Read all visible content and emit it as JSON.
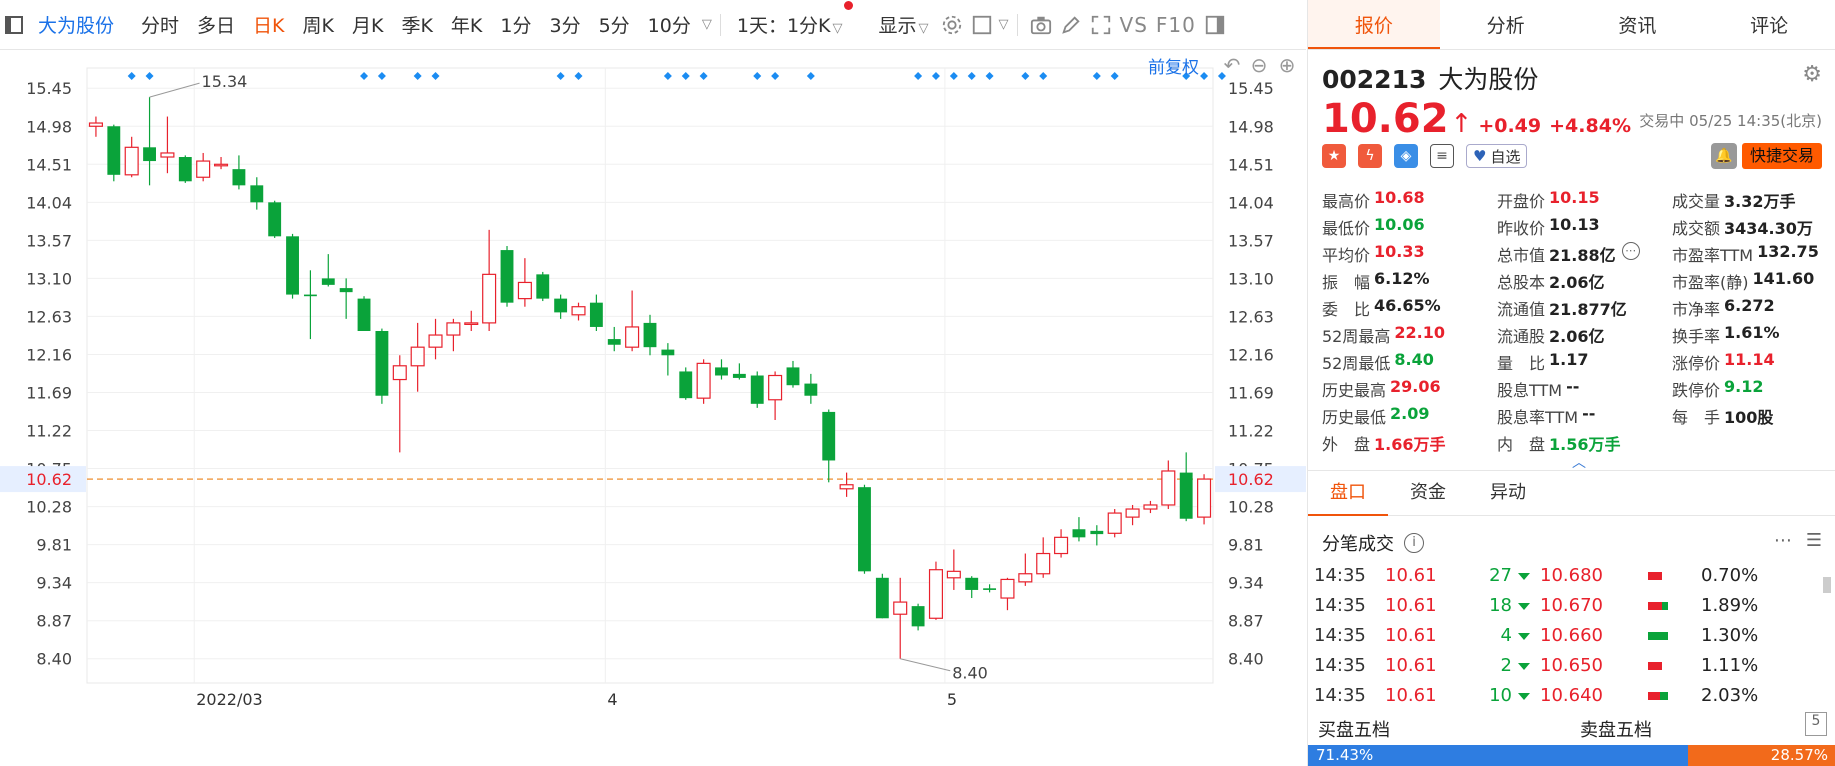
{
  "toolbar": {
    "stock_name": "大为股份",
    "periods": [
      "分时",
      "多日",
      "日K",
      "周K",
      "月K",
      "季K",
      "年K",
      "1分",
      "3分",
      "5分",
      "10分"
    ],
    "active_period": "日K",
    "interval_select": "1天：1分K",
    "display_label": "显示",
    "vs_label": "VS",
    "f10_label": "F10",
    "accent_color": "#f0540b"
  },
  "chart": {
    "restore_label": "前复权",
    "current_price_label": "10.62",
    "max_label": "15.34",
    "min_label": "8.40",
    "up_color": "#e8212c",
    "down_color": "#0aa33a"
  },
  "chart_data": {
    "type": "candlestick",
    "ylim": [
      8.1,
      15.7
    ],
    "yticks": [
      15.45,
      14.98,
      14.51,
      14.04,
      13.57,
      13.1,
      12.63,
      12.16,
      11.69,
      11.22,
      10.75,
      10.28,
      9.81,
      9.34,
      8.87,
      8.4
    ],
    "x_tick_labels": [
      {
        "label": "2022/03",
        "index": 6
      },
      {
        "label": "4",
        "index": 29
      },
      {
        "label": "5",
        "index": 48
      }
    ],
    "current_price": 10.62,
    "candles": [
      {
        "o": 14.98,
        "h": 15.1,
        "l": 14.85,
        "c": 15.02
      },
      {
        "o": 14.98,
        "h": 15.0,
        "l": 14.3,
        "c": 14.38
      },
      {
        "o": 14.38,
        "h": 14.85,
        "l": 14.35,
        "c": 14.72
      },
      {
        "o": 14.72,
        "h": 15.34,
        "l": 14.25,
        "c": 14.55
      },
      {
        "o": 14.6,
        "h": 15.1,
        "l": 14.4,
        "c": 14.65
      },
      {
        "o": 14.6,
        "h": 14.62,
        "l": 14.28,
        "c": 14.3
      },
      {
        "o": 14.35,
        "h": 14.65,
        "l": 14.3,
        "c": 14.55
      },
      {
        "o": 14.51,
        "h": 14.6,
        "l": 14.45,
        "c": 14.51
      },
      {
        "o": 14.45,
        "h": 14.62,
        "l": 14.2,
        "c": 14.25
      },
      {
        "o": 14.25,
        "h": 14.35,
        "l": 13.95,
        "c": 14.04
      },
      {
        "o": 14.04,
        "h": 14.06,
        "l": 13.6,
        "c": 13.62
      },
      {
        "o": 13.62,
        "h": 13.65,
        "l": 12.85,
        "c": 12.9
      },
      {
        "o": 12.9,
        "h": 13.2,
        "l": 12.35,
        "c": 12.88
      },
      {
        "o": 13.1,
        "h": 13.4,
        "l": 13.0,
        "c": 13.02
      },
      {
        "o": 12.98,
        "h": 13.1,
        "l": 12.6,
        "c": 12.93
      },
      {
        "o": 12.85,
        "h": 12.88,
        "l": 12.45,
        "c": 12.45
      },
      {
        "o": 12.45,
        "h": 12.48,
        "l": 11.55,
        "c": 11.65
      },
      {
        "o": 11.85,
        "h": 12.15,
        "l": 10.95,
        "c": 12.02
      },
      {
        "o": 12.02,
        "h": 12.55,
        "l": 11.7,
        "c": 12.25
      },
      {
        "o": 12.25,
        "h": 12.6,
        "l": 12.1,
        "c": 12.4
      },
      {
        "o": 12.4,
        "h": 12.6,
        "l": 12.2,
        "c": 12.55
      },
      {
        "o": 12.55,
        "h": 12.7,
        "l": 12.45,
        "c": 12.55
      },
      {
        "o": 12.55,
        "h": 13.7,
        "l": 12.45,
        "c": 13.15
      },
      {
        "o": 13.45,
        "h": 13.5,
        "l": 12.75,
        "c": 12.8
      },
      {
        "o": 12.85,
        "h": 13.35,
        "l": 12.75,
        "c": 13.05
      },
      {
        "o": 13.15,
        "h": 13.18,
        "l": 12.82,
        "c": 12.85
      },
      {
        "o": 12.85,
        "h": 12.9,
        "l": 12.6,
        "c": 12.68
      },
      {
        "o": 12.65,
        "h": 12.8,
        "l": 12.58,
        "c": 12.75
      },
      {
        "o": 12.8,
        "h": 12.9,
        "l": 12.45,
        "c": 12.5
      },
      {
        "o": 12.35,
        "h": 12.5,
        "l": 12.2,
        "c": 12.28
      },
      {
        "o": 12.25,
        "h": 12.95,
        "l": 12.2,
        "c": 12.5
      },
      {
        "o": 12.55,
        "h": 12.65,
        "l": 12.15,
        "c": 12.25
      },
      {
        "o": 12.22,
        "h": 12.3,
        "l": 11.9,
        "c": 12.15
      },
      {
        "o": 11.95,
        "h": 12.0,
        "l": 11.6,
        "c": 11.62
      },
      {
        "o": 11.62,
        "h": 12.1,
        "l": 11.55,
        "c": 12.05
      },
      {
        "o": 12.0,
        "h": 12.1,
        "l": 11.85,
        "c": 11.9
      },
      {
        "o": 11.92,
        "h": 12.05,
        "l": 11.85,
        "c": 11.87
      },
      {
        "o": 11.9,
        "h": 11.95,
        "l": 11.5,
        "c": 11.55
      },
      {
        "o": 11.6,
        "h": 11.95,
        "l": 11.35,
        "c": 11.9
      },
      {
        "o": 12.0,
        "h": 12.08,
        "l": 11.75,
        "c": 11.78
      },
      {
        "o": 11.8,
        "h": 11.92,
        "l": 11.55,
        "c": 11.65
      },
      {
        "o": 11.45,
        "h": 11.48,
        "l": 10.58,
        "c": 10.85
      },
      {
        "o": 10.5,
        "h": 10.7,
        "l": 10.4,
        "c": 10.55
      },
      {
        "o": 10.52,
        "h": 10.55,
        "l": 9.45,
        "c": 9.48
      },
      {
        "o": 9.4,
        "h": 9.45,
        "l": 8.9,
        "c": 8.9
      },
      {
        "o": 8.95,
        "h": 9.4,
        "l": 8.4,
        "c": 9.1
      },
      {
        "o": 9.05,
        "h": 9.08,
        "l": 8.75,
        "c": 8.8
      },
      {
        "o": 8.9,
        "h": 9.6,
        "l": 8.88,
        "c": 9.5
      },
      {
        "o": 9.4,
        "h": 9.75,
        "l": 9.25,
        "c": 9.48
      },
      {
        "o": 9.4,
        "h": 9.42,
        "l": 9.15,
        "c": 9.25
      },
      {
        "o": 9.27,
        "h": 9.32,
        "l": 9.22,
        "c": 9.25
      },
      {
        "o": 9.15,
        "h": 9.4,
        "l": 9.0,
        "c": 9.38
      },
      {
        "o": 9.35,
        "h": 9.7,
        "l": 9.3,
        "c": 9.45
      },
      {
        "o": 9.45,
        "h": 9.9,
        "l": 9.4,
        "c": 9.7
      },
      {
        "o": 9.7,
        "h": 10.0,
        "l": 9.65,
        "c": 9.9
      },
      {
        "o": 10.0,
        "h": 10.15,
        "l": 9.85,
        "c": 9.9
      },
      {
        "o": 9.98,
        "h": 10.05,
        "l": 9.8,
        "c": 9.94
      },
      {
        "o": 9.95,
        "h": 10.25,
        "l": 9.9,
        "c": 10.2
      },
      {
        "o": 10.15,
        "h": 10.3,
        "l": 10.05,
        "c": 10.25
      },
      {
        "o": 10.25,
        "h": 10.35,
        "l": 10.2,
        "c": 10.3
      },
      {
        "o": 10.3,
        "h": 10.85,
        "l": 10.25,
        "c": 10.72
      },
      {
        "o": 10.7,
        "h": 10.95,
        "l": 10.1,
        "c": 10.13
      },
      {
        "o": 10.15,
        "h": 10.68,
        "l": 10.06,
        "c": 10.62
      }
    ],
    "marker_indices": [
      2,
      3,
      15,
      16,
      18,
      19,
      26,
      27,
      32,
      33,
      34,
      37,
      38,
      40,
      46,
      47,
      48,
      49,
      50,
      52,
      53,
      56,
      57,
      61,
      62,
      63
    ]
  },
  "panel": {
    "tabs": [
      "报价",
      "分析",
      "资讯",
      "评论"
    ],
    "active_tab": "报价",
    "code": "002213",
    "name": "大为股份",
    "price": "10.62",
    "change": "+0.49",
    "change_pct": "+4.84%",
    "status": "交易中 05/25 14:35(北京)",
    "fav_label": "自选",
    "quick_trade": "快捷交易",
    "quote_rows": [
      [
        {
          "l": "最高价",
          "v": "10.68",
          "c": "red"
        },
        {
          "l": "开盘价",
          "v": "10.15",
          "c": "red"
        },
        {
          "l": "成交量",
          "v": "3.32万手",
          "c": ""
        }
      ],
      [
        {
          "l": "最低价",
          "v": "10.06",
          "c": "green"
        },
        {
          "l": "昨收价",
          "v": "10.13",
          "c": ""
        },
        {
          "l": "成交额",
          "v": "3434.30万",
          "c": ""
        }
      ],
      [
        {
          "l": "平均价",
          "v": "10.33",
          "c": "red"
        },
        {
          "l": "总市值",
          "v": "21.88亿",
          "c": ""
        },
        {
          "l": "市盈率TTM",
          "v": "132.75",
          "c": ""
        }
      ],
      [
        {
          "l": "振　幅",
          "v": "6.12%",
          "c": ""
        },
        {
          "l": "总股本",
          "v": "2.06亿",
          "c": ""
        },
        {
          "l": "市盈率(静)",
          "v": "141.60",
          "c": ""
        }
      ],
      [
        {
          "l": "委　比",
          "v": "46.65%",
          "c": ""
        },
        {
          "l": "流通值",
          "v": "21.877亿",
          "c": ""
        },
        {
          "l": "市净率",
          "v": "6.272",
          "c": ""
        }
      ],
      [
        {
          "l": "52周最高",
          "v": "22.10",
          "c": "red"
        },
        {
          "l": "流通股",
          "v": "2.06亿",
          "c": ""
        },
        {
          "l": "换手率",
          "v": "1.61%",
          "c": ""
        }
      ],
      [
        {
          "l": "52周最低",
          "v": "8.40",
          "c": "green"
        },
        {
          "l": "量　比",
          "v": "1.17",
          "c": ""
        },
        {
          "l": "涨停价",
          "v": "11.14",
          "c": "red"
        }
      ],
      [
        {
          "l": "历史最高",
          "v": "29.06",
          "c": "red"
        },
        {
          "l": "股息TTM",
          "v": "--",
          "c": ""
        },
        {
          "l": "跌停价",
          "v": "9.12",
          "c": "green"
        }
      ],
      [
        {
          "l": "历史最低",
          "v": "2.09",
          "c": "green"
        },
        {
          "l": "股息率TTM",
          "v": "--",
          "c": ""
        },
        {
          "l": "每　手",
          "v": "100股",
          "c": ""
        }
      ],
      [
        {
          "l": "外　盘",
          "v": "1.66万手",
          "c": "red"
        },
        {
          "l": "内　盘",
          "v": "1.56万手",
          "c": "green"
        },
        {
          "l": "",
          "v": "",
          "c": ""
        }
      ]
    ],
    "sub_tabs": [
      "盘口",
      "资金",
      "异动"
    ],
    "active_sub_tab": "盘口",
    "ticks_title": "分笔成交",
    "ticks": [
      {
        "time": "14:35",
        "price": "10.61",
        "vol": "27",
        "bid": "10.680",
        "pct": "0.70%",
        "red": 0.7,
        "green": 0
      },
      {
        "time": "14:35",
        "price": "10.61",
        "vol": "18",
        "bid": "10.670",
        "pct": "1.89%",
        "red": 0.7,
        "green": 0.3
      },
      {
        "time": "14:35",
        "price": "10.61",
        "vol": "4",
        "bid": "10.660",
        "pct": "1.30%",
        "red": 0,
        "green": 1
      },
      {
        "time": "14:35",
        "price": "10.61",
        "vol": "2",
        "bid": "10.650",
        "pct": "1.11%",
        "red": 0.7,
        "green": 0
      },
      {
        "time": "14:35",
        "price": "10.61",
        "vol": "10",
        "bid": "10.640",
        "pct": "2.03%",
        "red": 0.6,
        "green": 0.4
      }
    ],
    "buy_label": "买盘五档",
    "sell_label": "卖盘五档",
    "buy_pct": "71.43%",
    "sell_pct": "28.57%",
    "page_num": "5"
  }
}
